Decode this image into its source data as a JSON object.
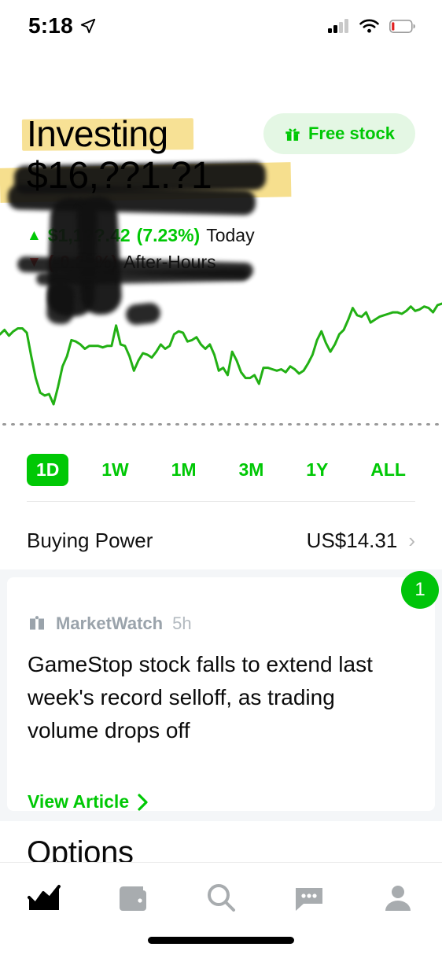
{
  "status_bar": {
    "time": "5:18",
    "location_icon": "location-arrow-icon",
    "signal_icon": "cellular-signal-icon",
    "wifi_icon": "wifi-icon",
    "battery_icon": "battery-low-icon",
    "battery_color": "#e02020"
  },
  "header": {
    "title": "Investing",
    "highlight_color": "#f5d97a",
    "free_stock": {
      "label": "Free stock",
      "icon": "gift-icon",
      "text_color": "#00c805",
      "background_color": "#e4f7e4"
    }
  },
  "portfolio": {
    "value": "$16,??1.?1",
    "value_redacted": true,
    "today": {
      "arrow": "▲",
      "amount": "$1,1??.42",
      "percent": "(7.23%)",
      "label": "Today",
      "color": "#00c805"
    },
    "after_hours": {
      "arrow": "▼",
      "amount": "",
      "percent": "(-0.23%)",
      "label": "After-Hours",
      "color": "#e03030"
    }
  },
  "chart_data": {
    "type": "line",
    "title": "",
    "xlabel": "",
    "ylabel": "",
    "line_color": "#22b014",
    "grid": false,
    "baseline_style": "dotted",
    "legend": "none",
    "ylim": [
      0,
      100
    ],
    "x": [
      0,
      1,
      2,
      3,
      4,
      5,
      6,
      7,
      8,
      9,
      10,
      11,
      12,
      13,
      14,
      15,
      16,
      17,
      18,
      19,
      20,
      21,
      22,
      23,
      24,
      25,
      26,
      27,
      28,
      29,
      30,
      31,
      32,
      33,
      34,
      35,
      36,
      37,
      38,
      39,
      40,
      41,
      42,
      43,
      44,
      45,
      46,
      47,
      48,
      49,
      50,
      51,
      52,
      53,
      54,
      55,
      56,
      57,
      58,
      59,
      60,
      61,
      62,
      63,
      64,
      65,
      66,
      67,
      68,
      69,
      70,
      71,
      72,
      73,
      74,
      75,
      76,
      77,
      78,
      79,
      80,
      81,
      82,
      83,
      84,
      85,
      86,
      87,
      88,
      89,
      90,
      91,
      92,
      93,
      94,
      95,
      96,
      97,
      98,
      99
    ],
    "values": [
      70,
      73,
      69,
      72,
      74,
      74,
      71,
      55,
      40,
      30,
      28,
      29,
      22,
      34,
      48,
      55,
      66,
      65,
      63,
      60,
      62,
      62,
      62,
      61,
      62,
      62,
      76,
      63,
      62,
      55,
      45,
      52,
      57,
      56,
      54,
      58,
      63,
      60,
      62,
      70,
      72,
      71,
      65,
      66,
      68,
      63,
      60,
      63,
      56,
      45,
      47,
      42,
      58,
      52,
      44,
      40,
      40,
      42,
      36,
      47,
      47,
      46,
      45,
      46,
      44,
      48,
      46,
      43,
      45,
      50,
      56,
      66,
      72,
      64,
      58,
      63,
      70,
      73,
      80,
      88,
      83,
      82,
      85,
      78,
      80,
      82,
      83,
      84,
      85,
      85,
      84,
      86,
      89,
      86,
      87,
      89,
      88,
      85,
      90,
      91
    ]
  },
  "ranges": {
    "items": [
      {
        "label": "1D",
        "active": true
      },
      {
        "label": "1W",
        "active": false
      },
      {
        "label": "1M",
        "active": false
      },
      {
        "label": "3M",
        "active": false
      },
      {
        "label": "1Y",
        "active": false
      },
      {
        "label": "ALL",
        "active": false
      }
    ],
    "active_color": "#00c805"
  },
  "buying_power": {
    "label": "Buying Power",
    "value": "US$14.31",
    "chevron": "›"
  },
  "news": {
    "badge": "1",
    "badge_color": "#00c40a",
    "source": "MarketWatch",
    "source_icon": "open-book-icon",
    "time": "5h",
    "headline": "GameStop stock falls to extend last week's record selloff, as trading volume drops off",
    "cta": "View Article",
    "cta_chevron": "›"
  },
  "options": {
    "heading": "Options"
  },
  "tab_bar": {
    "items": [
      {
        "name": "investing-tab",
        "icon": "chart-trending-icon",
        "active": true
      },
      {
        "name": "wallet-tab",
        "icon": "wallet-icon",
        "active": false
      },
      {
        "name": "search-tab",
        "icon": "search-icon",
        "active": false
      },
      {
        "name": "messages-tab",
        "icon": "chat-bubble-icon",
        "active": false
      },
      {
        "name": "profile-tab",
        "icon": "person-icon",
        "active": false
      }
    ],
    "active_color": "#000000",
    "inactive_color": "#a8acaf"
  }
}
